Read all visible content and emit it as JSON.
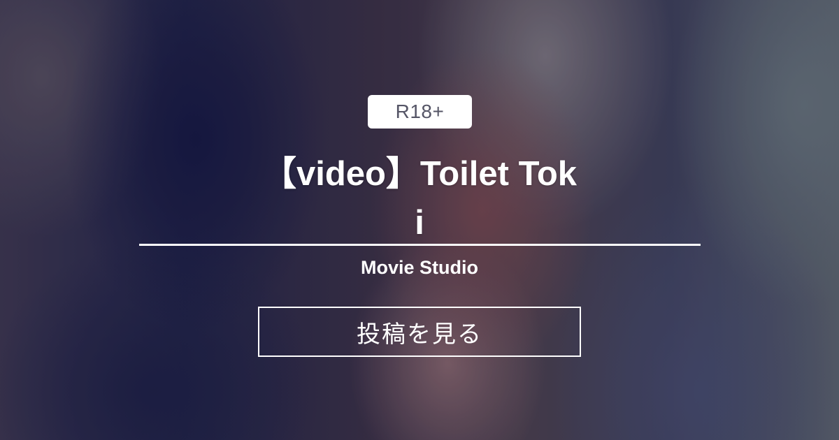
{
  "badge": {
    "label": "R18+"
  },
  "post": {
    "title": "【video】Toilet Toki",
    "creator": "Movie Studio"
  },
  "actions": {
    "view_post_label": "投稿を見る"
  },
  "colors": {
    "text": "#ffffff",
    "badge_background": "#ffffff",
    "badge_text": "#555566",
    "background_dominant": "#2b2940"
  }
}
